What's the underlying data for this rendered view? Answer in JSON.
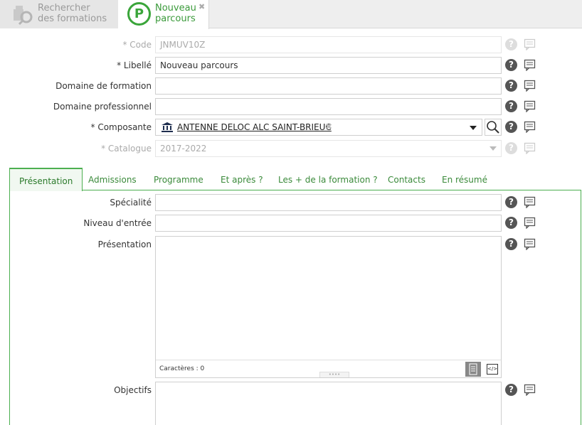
{
  "top_tabs": [
    {
      "line1": "Rechercher",
      "line2": "des formations",
      "icon": "search-training-icon"
    },
    {
      "line1": "Nouveau",
      "line2": "parcours",
      "icon": "parcours-p-icon",
      "badge": "P",
      "close": "✖"
    }
  ],
  "form": {
    "code": {
      "label": "* Code",
      "value": "JNMUV10Z"
    },
    "libelle": {
      "label": "* Libellé",
      "value": "Nouveau parcours"
    },
    "domaine_formation": {
      "label": "Domaine de formation",
      "value": ""
    },
    "domaine_professionnel": {
      "label": "Domaine professionnel",
      "value": ""
    },
    "composante": {
      "label": "* Composante",
      "value": "ANTENNE DELOC ALC SAINT-BRIEUC",
      "remove": "✖"
    },
    "catalogue": {
      "label": "* Catalogue",
      "value": "2017-2022"
    }
  },
  "help_glyph": "?",
  "inner_tabs": [
    "Présentation",
    "Admissions",
    "Programme",
    "Et après ?",
    "Les + de la formation ?",
    "Contacts",
    "En résumé"
  ],
  "presentation_panel": {
    "specialite": {
      "label": "Spécialité",
      "value": ""
    },
    "niveau_entree": {
      "label": "Niveau d'entrée",
      "value": ""
    },
    "presentation": {
      "label": "Présentation",
      "counter": "Caractères : 0",
      "grip": "••••",
      "source_btn": "</>"
    },
    "objectifs": {
      "label": "Objectifs"
    }
  },
  "colors": {
    "accent": "#4caf50",
    "accent_text": "#3a8a3a"
  }
}
